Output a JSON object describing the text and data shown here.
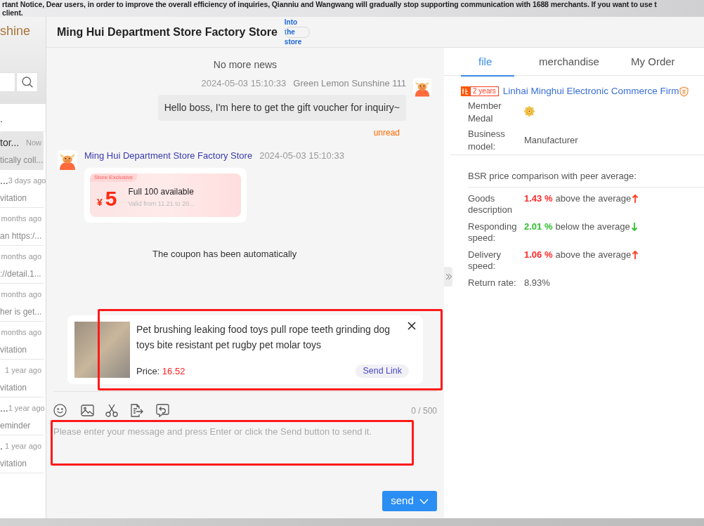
{
  "notice": [
    "rtant Notice, Dear users, in order to improve the overall efficiency of inquiries, Qianniu and Wangwang will gradually stop supporting communication with 1688 merchants. If you want to use t",
    "client."
  ],
  "sidebar": {
    "account_name": "shine",
    "list_header": ".",
    "conversations": [
      {
        "name": "tor...",
        "time": "Now",
        "preview": "tically coll...",
        "selected": true
      },
      {
        "name": "...",
        "time": "3 days ago",
        "preview": "vitation",
        "selected": false
      },
      {
        "time": "months ago",
        "preview": "an https:/...",
        "selected": false
      },
      {
        "time": "months ago",
        "preview": "://detail.1...",
        "selected": false
      },
      {
        "time": "months ago",
        "preview": "her is get...",
        "selected": false
      },
      {
        "time": "months ago",
        "preview": "vitation",
        "selected": false
      },
      {
        "time": "1 year ago",
        "preview": "vitation",
        "selected": false
      },
      {
        "name": "...",
        "time": "1 year ago",
        "preview": "eminder",
        "selected": false
      },
      {
        "name": ".",
        "time": "1 year ago",
        "preview": "vitation",
        "selected": false
      }
    ]
  },
  "chat": {
    "title": "Ming Hui Department Store Factory Store",
    "store_link": "Into the store",
    "history_note": "No more news",
    "messages": [
      {
        "kind": "text",
        "outgoing": true,
        "time": "2024-05-03 15:10:33",
        "sender": "Green Lemon Sunshine 111",
        "text": "Hello boss, I'm here to get the gift voucher for inquiry~",
        "status": "unread"
      },
      {
        "kind": "coupon",
        "outgoing": false,
        "sender": "Ming Hui Department Store Factory Store",
        "time": "2024-05-03 15:10:33",
        "coupon": {
          "tag": "Store Exclusive",
          "currency": "¥",
          "amount": "5",
          "condition": "Full 100 available",
          "validity": "Valid from 11.21 to 20..."
        }
      },
      {
        "kind": "system",
        "text": "The coupon has been automatically"
      }
    ],
    "product_card": {
      "title": "Pet brushing leaking food toys pull rope teeth grinding dog toys bite resistant pet rugby pet molar toys",
      "price_label": "Price:",
      "price": "16.52",
      "action": "Send Link",
      "highlighted": true
    },
    "composer": {
      "counter": "0 / 500",
      "placeholder": "Please enter your message and press Enter or click the Send button to send it.",
      "highlighted": true,
      "send_label": "send"
    }
  },
  "profile": {
    "tabs": [
      {
        "label": "file",
        "selected": true
      },
      {
        "label": "merchandise",
        "selected": false
      },
      {
        "label": "My Order",
        "selected": false
      }
    ],
    "seller": {
      "years": "2 years",
      "name": "Linhai Minghui Electronic Commerce Firm"
    },
    "details": [
      {
        "label": "Member Medal",
        "kind": "medal"
      },
      {
        "label": "Business model:",
        "kind": "text",
        "value": "Manufacturer"
      }
    ],
    "comparison": {
      "title": "BSR price comparison with peer average:",
      "rows": [
        {
          "kind": "rise",
          "label": "Goods description",
          "value": "1.43 %",
          "note": "above the average"
        },
        {
          "kind": "fall",
          "label": "Responding speed:",
          "value": "2.01 %",
          "note": "below the average"
        },
        {
          "kind": "rise",
          "label": "Delivery speed:",
          "value": "1.06 %",
          "note": "above the average"
        },
        {
          "kind": "plain",
          "label": "Return rate:",
          "value": "8.93%"
        }
      ]
    }
  }
}
